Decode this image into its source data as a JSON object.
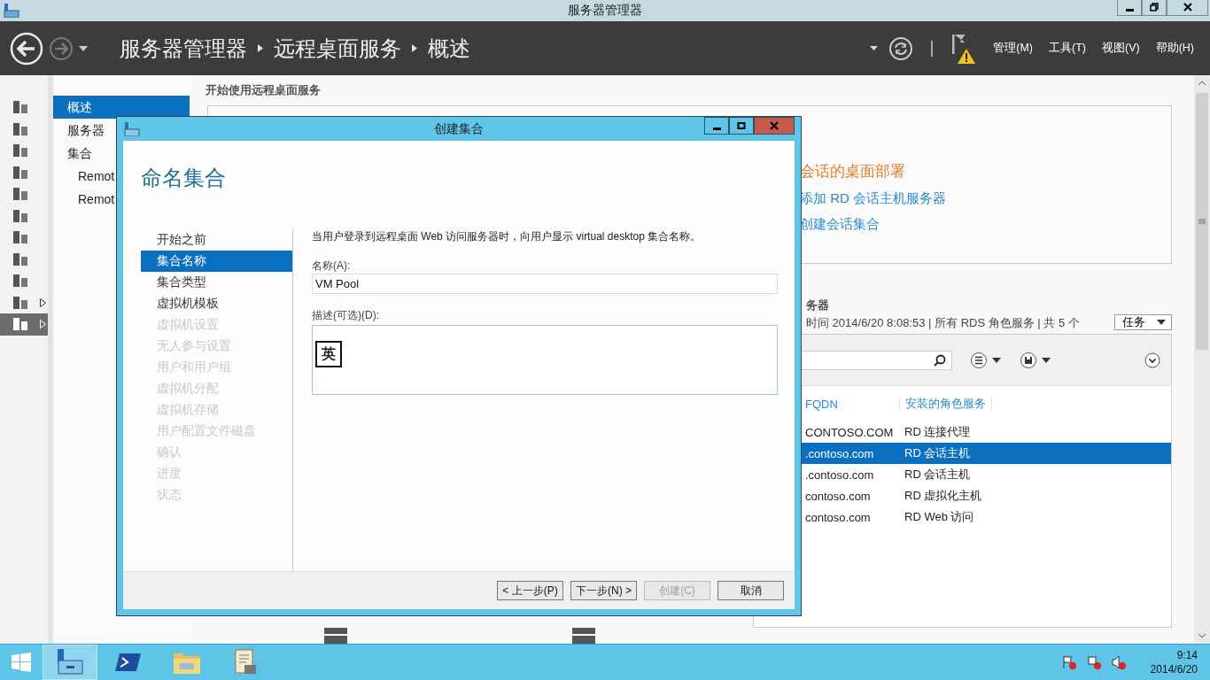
{
  "window": {
    "title": "服务器管理器"
  },
  "header": {
    "breadcrumb": [
      "服务器管理器",
      "远程桌面服务",
      "概述"
    ],
    "menus": [
      "管理(M)",
      "工具(T)",
      "视图(V)",
      "帮助(H)"
    ]
  },
  "rail": [
    {
      "selected": false,
      "expandable": false
    },
    {
      "selected": false,
      "expandable": false
    },
    {
      "selected": false,
      "expandable": false
    },
    {
      "selected": false,
      "expandable": false
    },
    {
      "selected": false,
      "expandable": false
    },
    {
      "selected": false,
      "expandable": false
    },
    {
      "selected": false,
      "expandable": false
    },
    {
      "selected": false,
      "expandable": false
    },
    {
      "selected": false,
      "expandable": false
    },
    {
      "selected": false,
      "expandable": true
    },
    {
      "selected": true,
      "expandable": true
    }
  ],
  "nav": [
    {
      "label": "概述",
      "selected": true
    },
    {
      "label": "服务器",
      "selected": false
    },
    {
      "label": "集合",
      "selected": false,
      "children": [
        {
          "label": "Remot",
          "selected": false
        },
        {
          "label": "Remot",
          "selected": false
        }
      ]
    }
  ],
  "content": {
    "heading": "开始使用远程桌面服务",
    "quick_start": {
      "title": "会话的桌面部署",
      "links": [
        "添加 RD 会话主机服务器",
        "创建会话集合"
      ]
    },
    "servers": {
      "title": "务器",
      "subtitle": "时间 2014/6/20 8:08:53 | 所有 RDS 角色服务 | 共 5 个",
      "tasks": "任务",
      "columns": [
        "FQDN",
        "安装的角色服务"
      ],
      "rows": [
        {
          "cells": [
            "CONTOSO.COM",
            "RD 连接代理"
          ],
          "selected": false
        },
        {
          "cells": [
            ".contoso.com",
            "RD 会话主机"
          ],
          "selected": true
        },
        {
          "cells": [
            ".contoso.com",
            "RD 会话主机"
          ],
          "selected": false
        },
        {
          "cells": [
            "contoso.com",
            "RD 虚拟化主机"
          ],
          "selected": false
        },
        {
          "cells": [
            "contoso.com",
            "RD Web 访问"
          ],
          "selected": false
        }
      ]
    }
  },
  "dialog": {
    "title": "创建集合",
    "heading": "命名集合",
    "steps": [
      {
        "label": "开始之前",
        "selected": false,
        "disabled": false
      },
      {
        "label": "集合名称",
        "selected": true,
        "disabled": false
      },
      {
        "label": "集合类型",
        "selected": false,
        "disabled": false
      },
      {
        "label": "虚拟机模板",
        "selected": false,
        "disabled": false
      },
      {
        "label": "虚拟机设置",
        "selected": false,
        "disabled": true
      },
      {
        "label": "无人参与设置",
        "selected": false,
        "disabled": true
      },
      {
        "label": "用户和用户组",
        "selected": false,
        "disabled": true
      },
      {
        "label": "虚拟机分配",
        "selected": false,
        "disabled": true
      },
      {
        "label": "虚拟机存储",
        "selected": false,
        "disabled": true
      },
      {
        "label": "用户配置文件磁盘",
        "selected": false,
        "disabled": true
      },
      {
        "label": "确认",
        "selected": false,
        "disabled": true
      },
      {
        "label": "进度",
        "selected": false,
        "disabled": true
      },
      {
        "label": "状态",
        "selected": false,
        "disabled": true
      }
    ],
    "description": "当用户登录到远程桌面 Web 访问服务器时，向用户显示 virtual desktop 集合名称。",
    "name_label": "名称(A):",
    "name_value": "VM Pool",
    "desc_label": "描述(可选)(D):",
    "ime": "英",
    "buttons": [
      {
        "label": "< 上一步(P)",
        "disabled": false
      },
      {
        "label": "下一步(N) >",
        "disabled": false
      },
      {
        "label": "创建(C)",
        "disabled": true
      },
      {
        "label": "取消",
        "disabled": false
      }
    ]
  },
  "taskbar": {
    "apps": [
      {
        "selected": true
      },
      {
        "selected": false
      },
      {
        "selected": false
      },
      {
        "selected": false
      }
    ],
    "time": "9:14",
    "date": "2014/6/20"
  }
}
